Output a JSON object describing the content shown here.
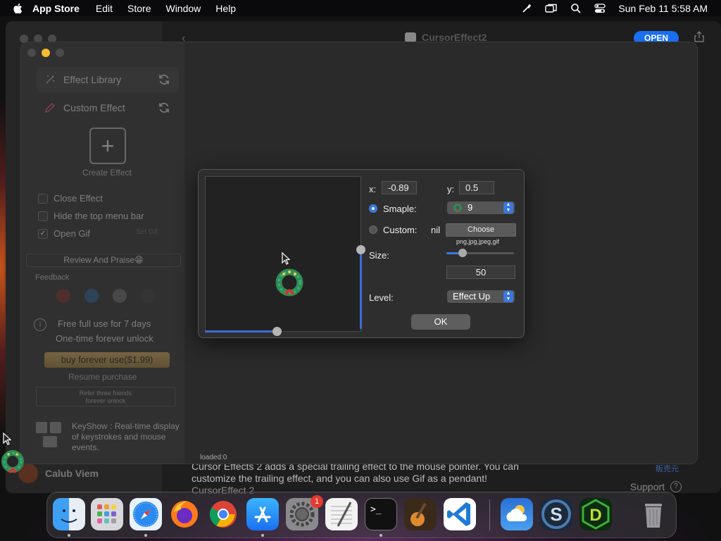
{
  "menubar": {
    "app_name": "App Store",
    "menus": [
      "Edit",
      "Store",
      "Window",
      "Help"
    ],
    "datetime": "Sun Feb 11  5:58 AM",
    "icons": [
      "apple-logo-icon",
      "pen-icon",
      "screen-mirror-icon",
      "spotlight-search-icon",
      "control-center-icon"
    ]
  },
  "appstore": {
    "back": "‹",
    "title": "CursorEffect2",
    "open_label": "OPEN",
    "description": [
      "Cursor Effects 2 adds a special trailing effect to the mouse pointer. You can",
      "customize the trailing effect, and you can also use Gif as a pendant!",
      "CursorEffect 2"
    ],
    "support_label": "Support",
    "support_q": "?",
    "cjk_link": "販売元",
    "user_name": "Calub Viem"
  },
  "sidebar": {
    "effect_library": "Effect Library",
    "custom_effect": "Custom Effect",
    "create_plus": "+",
    "create_effect": "Create Effect",
    "checks": [
      {
        "label": "Close Effect",
        "checked": false
      },
      {
        "label": "Hide the top menu bar",
        "checked": false
      },
      {
        "label": "Open Gif",
        "checked": true
      }
    ],
    "check_mark": "✓",
    "set_gif": "Set Gif",
    "review": "Review And Praise😁",
    "feedback": "Feedback",
    "feedback_icons": [
      "youtube-icon",
      "twitter-icon",
      "mail-icon",
      "tiktok-icon"
    ],
    "info_i": "i",
    "free_line1": "Free full use for 7 days",
    "free_line2": "One-time forever unlock",
    "buy": "buy forever use($1.99)",
    "resume": "Resume purchase",
    "refer_line1": "Refer three friends",
    "refer_line2": "forever unlock",
    "keyshow": "KeyShow : Real-time display of keystrokes and mouse events.",
    "loaded": "loaded:0"
  },
  "dialog": {
    "x_label": "x:",
    "x_value": "-0.89",
    "y_label": "y:",
    "y_value": "0.5",
    "sample_label": "Smaple:",
    "sample_value": "9",
    "sample_selected": true,
    "custom_label": "Custom:",
    "custom_value": "nil",
    "choose": "Choose",
    "file_types": "png,jpg,jpeg,gif",
    "size_label": "Size:",
    "size_value": "50",
    "size_slider_fraction": 0.24,
    "level_label": "Level:",
    "level_value": "Effect Up",
    "ok": "OK",
    "preview_v_fraction": 0.5,
    "preview_h_fraction": 0.46
  },
  "dock": {
    "apps": [
      "Finder",
      "Launchpad",
      "Safari",
      "Firefox",
      "Chrome",
      "App Store",
      "System Settings",
      "TextEdit",
      "Terminal",
      "GarageBand",
      "Visual Studio Code",
      "Weather",
      "Scrivener",
      "Dash",
      "Trash"
    ],
    "settings_badge": "1",
    "terminal_prompt": ">_"
  },
  "colors": {
    "accent": "#3a78e0",
    "open_button": "#1a6ff0",
    "buy_button": "#c9a45a",
    "badge": "#e53a30"
  }
}
